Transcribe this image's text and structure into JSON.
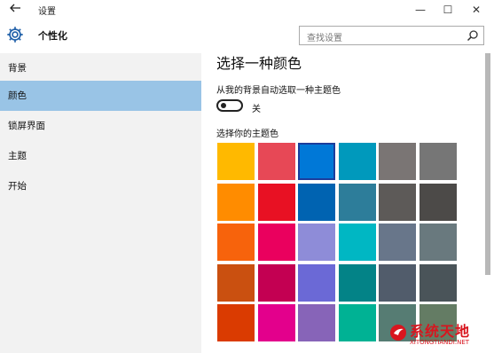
{
  "window": {
    "title": "设置",
    "back_icon": "arrow-left-icon",
    "minimize_glyph": "—",
    "maximize_glyph": "☐",
    "close_glyph": "✕"
  },
  "header": {
    "icon": "gear-icon",
    "title": "个性化",
    "search_placeholder": "查找设置"
  },
  "sidebar": {
    "items": [
      {
        "label": "背景",
        "selected": false
      },
      {
        "label": "颜色",
        "selected": true
      },
      {
        "label": "锁屏界面",
        "selected": false
      },
      {
        "label": "主题",
        "selected": false
      },
      {
        "label": "开始",
        "selected": false
      }
    ]
  },
  "main": {
    "section_title": "选择一种颜色",
    "auto_label": "从我的背景自动选取一种主题色",
    "toggle_state": "关",
    "toggle_on": false,
    "pick_label": "选择你的主题色",
    "swatches": [
      [
        "#ffb900",
        "#e74856",
        "#0078d7",
        "#0099bc",
        "#7a7574",
        "#767676"
      ],
      [
        "#ff8c00",
        "#e81123",
        "#0063b1",
        "#2d7d9a",
        "#5d5a58",
        "#4c4a48"
      ],
      [
        "#f7630c",
        "#ea005e",
        "#8e8cd8",
        "#00b7c3",
        "#68768a",
        "#69797e"
      ],
      [
        "#ca5010",
        "#c30052",
        "#6b69d6",
        "#038387",
        "#515c6b",
        "#4a5459"
      ],
      [
        "#da3b01",
        "#e3008c",
        "#8764b8",
        "#00b294",
        "#567c73",
        "#647c64"
      ]
    ],
    "selected_swatch": [
      0,
      2
    ]
  },
  "watermark": {
    "brand": "系统天地",
    "url": "XITONGTIANDI.NET",
    "color": "#d8151e"
  }
}
